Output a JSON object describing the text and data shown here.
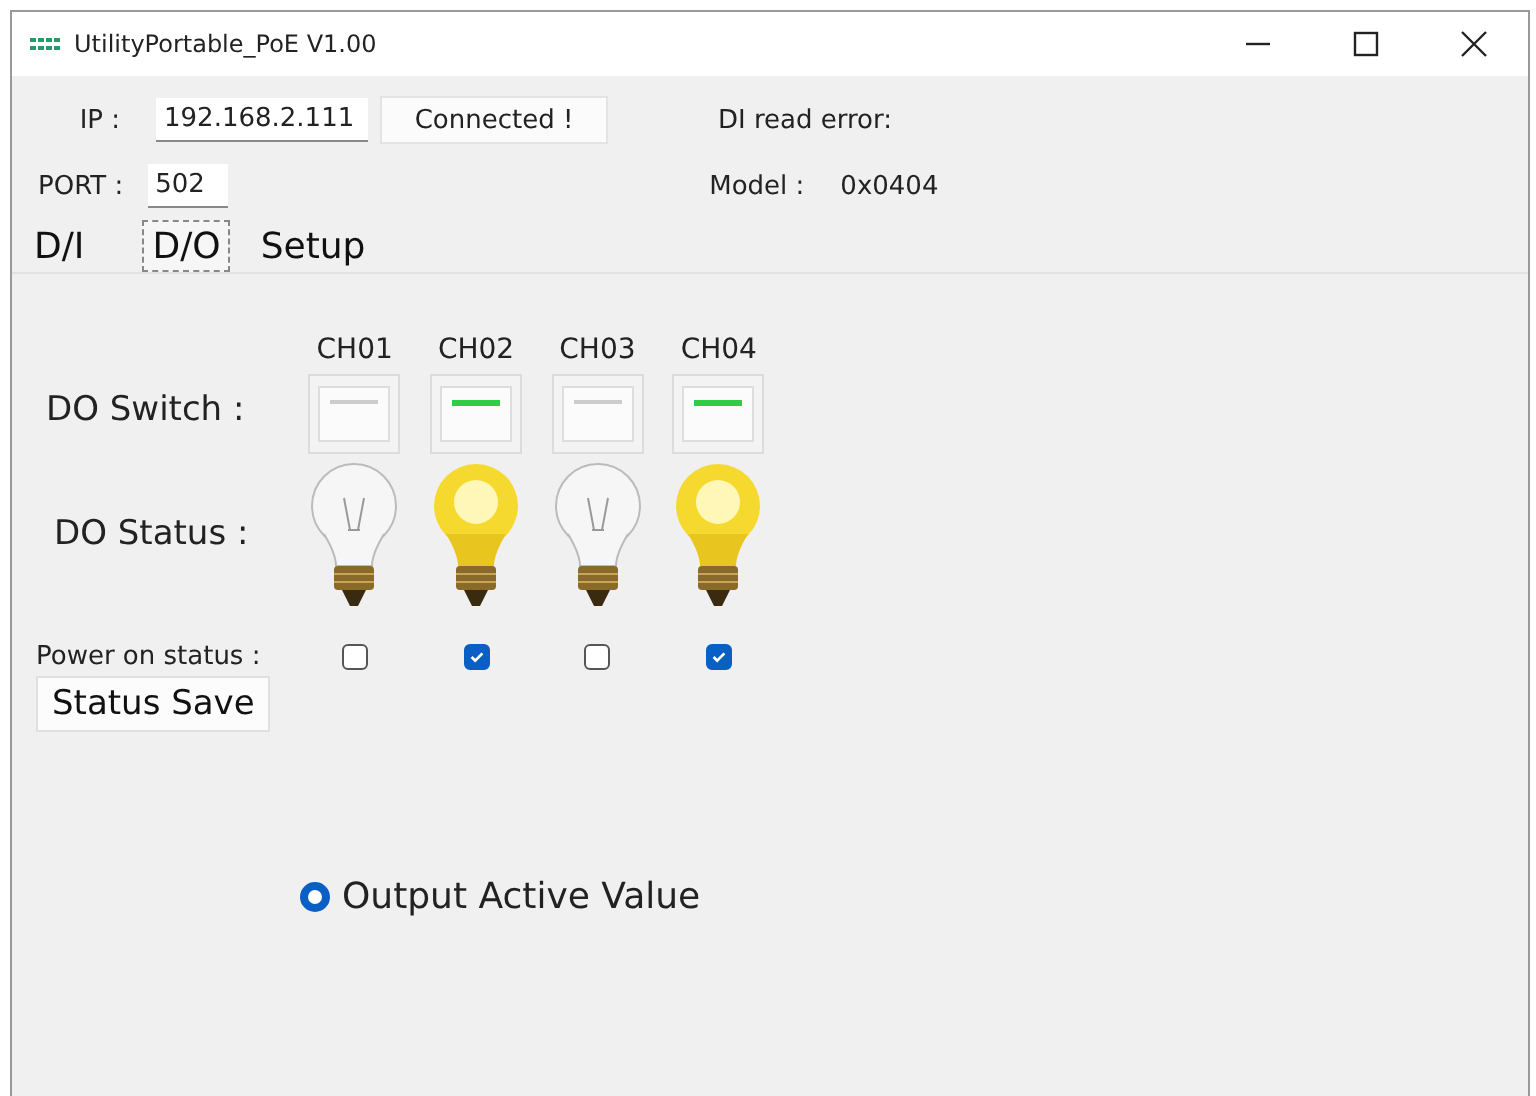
{
  "window": {
    "title": "UtilityPortable_PoE V1.00"
  },
  "connection": {
    "ip_label": "IP :",
    "ip": "192.168.2.111",
    "connect_button": "Connected !",
    "port_label": "PORT :",
    "port": "502",
    "di_error": "DI read error:",
    "model_label": "Model :",
    "model": "0x0404"
  },
  "tabs": [
    {
      "label": "D/I",
      "selected": false
    },
    {
      "label": "D/O",
      "selected": true
    },
    {
      "label": "Setup",
      "selected": false
    }
  ],
  "do_switch_label": "DO Switch :",
  "do_status_label": "DO Status :",
  "power_on_label": "Power on status :",
  "channels": [
    {
      "name": "CH01",
      "on": false,
      "lit": false,
      "power_on": false
    },
    {
      "name": "CH02",
      "on": true,
      "lit": true,
      "power_on": true
    },
    {
      "name": "CH03",
      "on": false,
      "lit": false,
      "power_on": false
    },
    {
      "name": "CH04",
      "on": true,
      "lit": true,
      "power_on": true
    }
  ],
  "save_button": "Status Save",
  "radio": {
    "label": "Output Active Value",
    "selected": true
  }
}
